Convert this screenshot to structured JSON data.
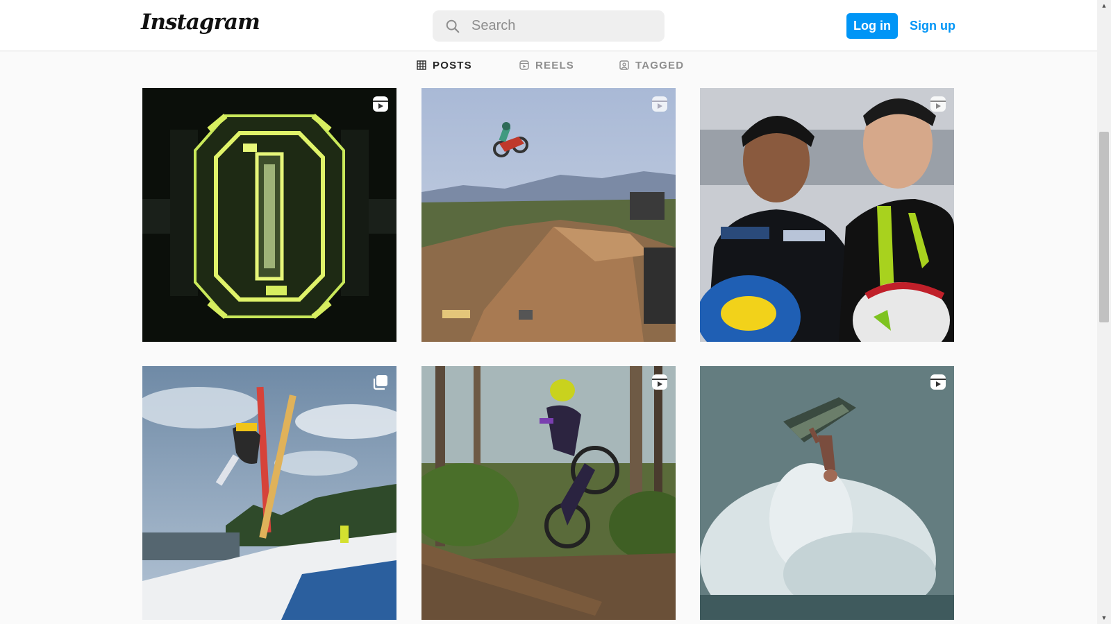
{
  "header": {
    "logo_text": "Instagram",
    "search_placeholder": "Search",
    "login_label": "Log in",
    "signup_label": "Sign up",
    "accent_color": "#0095f6"
  },
  "tabs": [
    {
      "label": "POSTS",
      "icon": "grid-icon",
      "active": true
    },
    {
      "label": "REELS",
      "icon": "reels-icon",
      "active": false
    },
    {
      "label": "TAGGED",
      "icon": "tagged-icon",
      "active": false
    }
  ],
  "posts": [
    {
      "subject": "illuminated-yellow-structure",
      "badge": "reel-icon"
    },
    {
      "subject": "freestyle-motocross-jump",
      "badge": "reel-icon"
    },
    {
      "subject": "two-racers-portrait",
      "badge": "reel-icon"
    },
    {
      "subject": "skier-flip",
      "badge": "carousel-icon"
    },
    {
      "subject": "mountain-bike-jump",
      "badge": "reel-icon"
    },
    {
      "subject": "jetski-flip",
      "badge": "reel-icon"
    }
  ]
}
